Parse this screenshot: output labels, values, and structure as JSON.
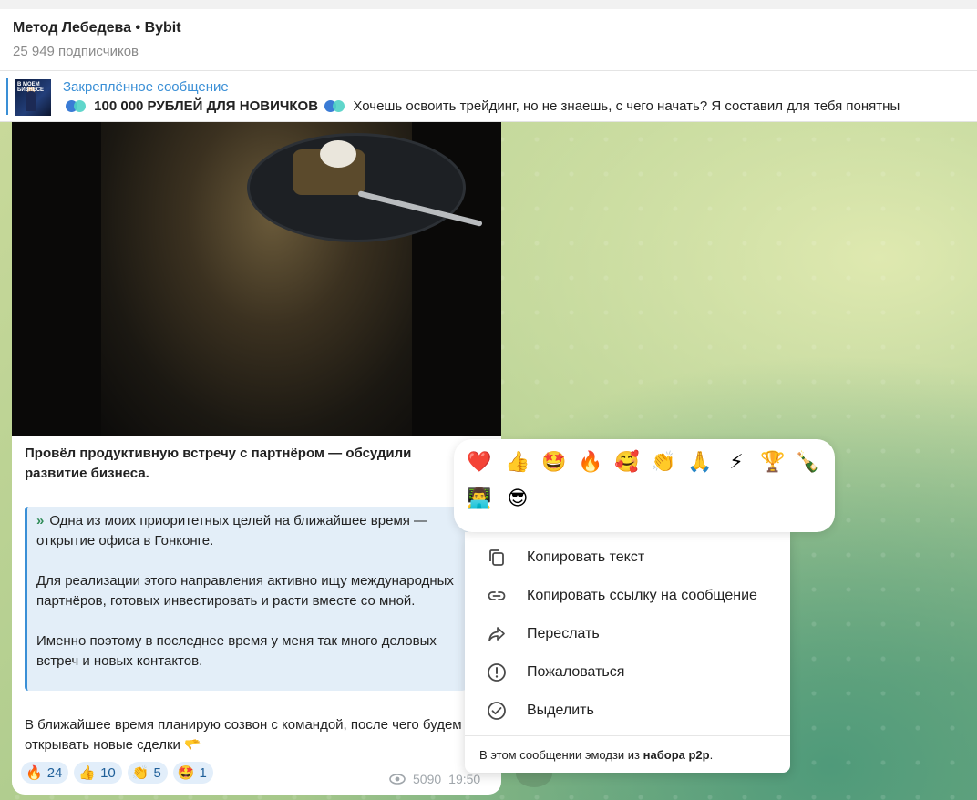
{
  "channel": {
    "title": "Метод Лебедева • Bybit",
    "subscribers": "25 949 подписчиков"
  },
  "pinned": {
    "label": "Закреплённое сообщение",
    "thumb_text": "В МОЕМ БИЗНЕСЕ",
    "headline": "100 000 РУБЛЕЙ ДЛЯ НОВИЧКОВ",
    "preview": "Хочешь освоить трейдинг, но не знаешь, с чего начать? Я составил для тебя понятны"
  },
  "message": {
    "bold_text": "Провёл продуктивную встречу с партнёром — обсудили развитие бизнеса.",
    "quote_paragraphs": [
      "Одна из моих приоритетных целей на ближайшее время — открытие офиса в Гонконге.",
      "Для реализации этого направления активно ищу международных партнёров, готовых инвестировать и расти вместе со мной.",
      "Именно поэтому в последнее время у меня так много деловых встреч и новых контактов."
    ],
    "tail_text": "В ближайшее время планирую созвон с командой, после чего будем открывать новые сделки",
    "tail_emoji": "🫳",
    "views": "5090",
    "time": "19:50",
    "reactions": [
      {
        "emoji": "🔥",
        "count": "24"
      },
      {
        "emoji": "👍",
        "count": "10"
      },
      {
        "emoji": "👏",
        "count": "5"
      },
      {
        "emoji": "🤩",
        "count": "1"
      }
    ]
  },
  "emoji_picker": [
    "❤️",
    "👍",
    "🤩",
    "🔥",
    "🥰",
    "👏",
    "🙏",
    "⚡",
    "🏆",
    "🍾",
    "👨‍💻",
    "😎"
  ],
  "context_menu": {
    "items": [
      {
        "label": "Копировать текст",
        "icon": "copy-icon"
      },
      {
        "label": "Копировать ссылку на сообщение",
        "icon": "link-icon"
      },
      {
        "label": "Переслать",
        "icon": "forward-icon"
      },
      {
        "label": "Пожаловаться",
        "icon": "report-icon"
      },
      {
        "label": "Выделить",
        "icon": "check-circle-icon"
      }
    ],
    "footer_prefix": "В этом сообщении эмодзи из ",
    "footer_link": "набора p2p",
    "footer_suffix": "."
  }
}
